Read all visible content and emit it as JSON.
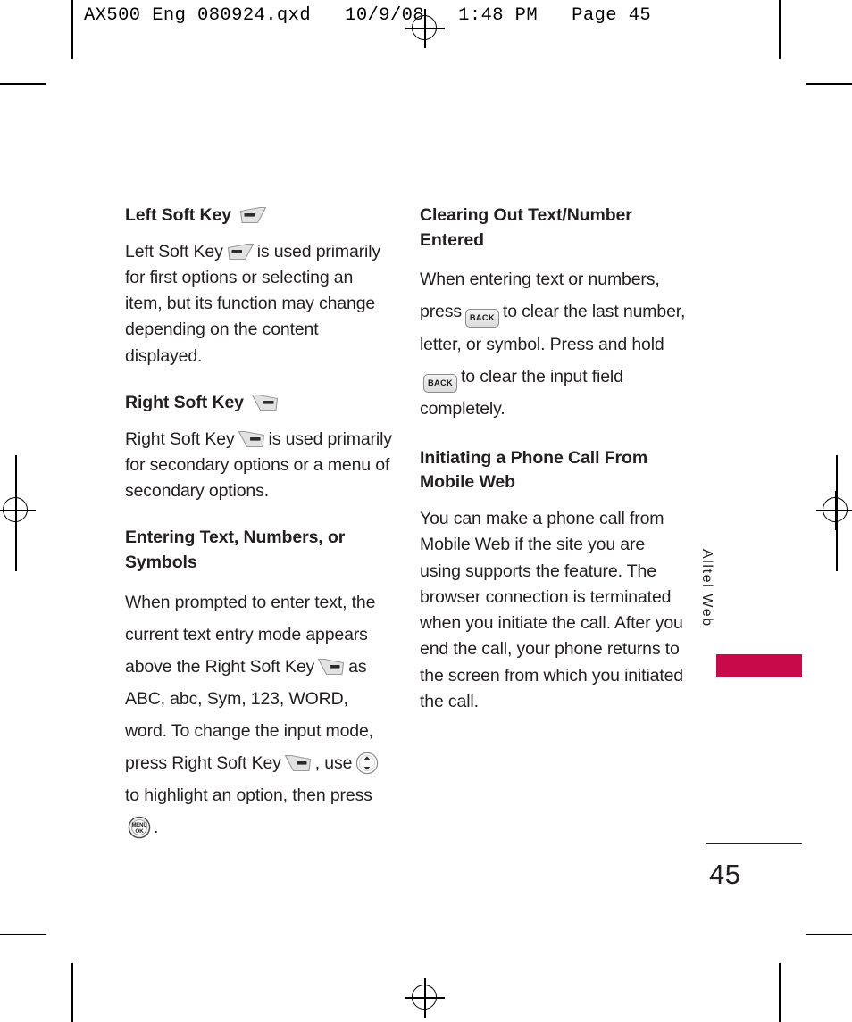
{
  "page": {
    "slug_line": "AX500_Eng_080924.qxd   10/9/08   1:48 PM   Page 45",
    "folio_number": "45",
    "side_tab_label": "Alltel Web",
    "side_tab_color": "#c80a4b",
    "text_color": "#231f20",
    "background": "#ffffff"
  },
  "left_column": {
    "sections": [
      {
        "heading": "Left Soft Key",
        "heading_icon": "left-soft-key-icon",
        "paragraph_parts": [
          {
            "type": "text",
            "value": "Left Soft Key"
          },
          {
            "type": "icon",
            "value": "left-soft-key-icon"
          },
          {
            "type": "text",
            "value": "is used primarily for first options or selecting an item, but its function may change depending on the content displayed."
          }
        ]
      },
      {
        "heading": "Right Soft Key",
        "heading_icon": "right-soft-key-icon",
        "paragraph_parts": [
          {
            "type": "text",
            "value": "Right Soft Key"
          },
          {
            "type": "icon",
            "value": "right-soft-key-icon"
          },
          {
            "type": "text",
            "value": "is used primarily for secondary options or a menu of secondary options."
          }
        ]
      },
      {
        "heading": "Entering Text, Numbers, or Symbols",
        "heading_icon": null,
        "paragraph_parts": [
          {
            "type": "text",
            "value": "When prompted to enter text, the current text entry mode appears above the Right Soft Key"
          },
          {
            "type": "icon",
            "value": "right-soft-key-icon"
          },
          {
            "type": "text",
            "value": "as ABC, abc, Sym, 123, WORD, word. To change the input mode, press Right Soft Key"
          },
          {
            "type": "icon",
            "value": "right-soft-key-icon"
          },
          {
            "type": "text",
            "value": ", use"
          },
          {
            "type": "icon",
            "value": "navigation-key-icon"
          },
          {
            "type": "text",
            "value": "to highlight an option, then press"
          },
          {
            "type": "icon",
            "value": "menu-ok-key-icon"
          },
          {
            "type": "text",
            "value": "."
          }
        ]
      }
    ]
  },
  "right_column": {
    "sections": [
      {
        "heading": "Clearing Out Text/Number Entered",
        "paragraph_parts": [
          {
            "type": "text",
            "value": "When entering text or numbers, press"
          },
          {
            "type": "icon",
            "value": "back-key-icon"
          },
          {
            "type": "text",
            "value": "to clear the last number, letter, or symbol. Press and hold"
          },
          {
            "type": "icon",
            "value": "back-key-icon"
          },
          {
            "type": "text",
            "value": "to clear the input field completely."
          }
        ]
      },
      {
        "heading": "Initiating a Phone Call From Mobile Web",
        "paragraph_parts": [
          {
            "type": "text",
            "value": "You can make a phone call from Mobile Web if the site you are using supports the feature. The browser connection is terminated when you initiate the call. After you end the call, your phone returns to the screen from which you initiated the call."
          }
        ]
      }
    ]
  },
  "icons": {
    "back_key_label": "BACK",
    "menu_ok_key_line1": "MENU",
    "menu_ok_key_line2": "OK"
  },
  "text_fragments": {
    "lsk_head": "Left Soft Key",
    "lsk_p1": "Left Soft Key",
    "lsk_p2": "is used primarily for first options or selecting an item, but its function may change depending on the content displayed.",
    "rsk_head": "Right Soft Key",
    "rsk_p1": "Right Soft Key",
    "rsk_p2": "is used primarily for secondary options or a menu of secondary options.",
    "ent_head": "Entering Text, Numbers, or Symbols",
    "ent_p1": "When prompted to enter text, the current text entry mode appears above the Right Soft Key",
    "ent_p2": "as ABC, abc, Sym, 123, WORD, word. To change the input mode, press Right Soft Key",
    "ent_p3": ", use",
    "ent_p4": "to highlight an option, then press",
    "ent_p5": ".",
    "clr_head": "Clearing Out Text/Number Entered",
    "clr_p1": "When entering text or numbers, press",
    "clr_p2": "to clear the last number, letter, or symbol. Press and hold",
    "clr_p3": "to clear the input field completely.",
    "init_head": "Initiating a Phone Call From Mobile Web",
    "init_p1": "You can make a phone call from Mobile Web if the site you are using supports the feature. The browser connection is terminated when you initiate the call. After you end the call, your phone returns to the screen from which you initiated the call."
  }
}
